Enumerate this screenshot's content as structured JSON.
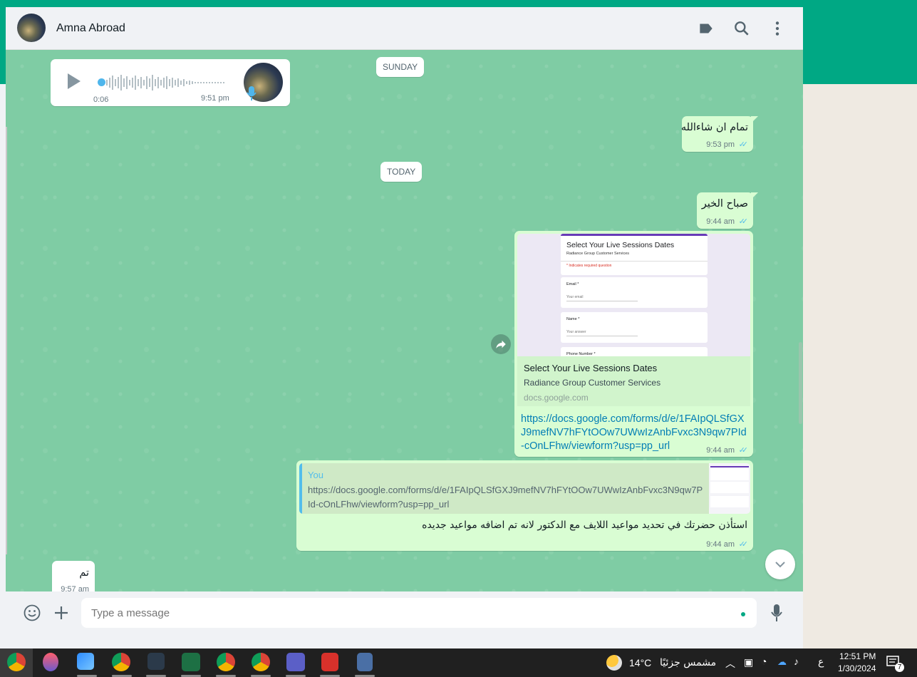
{
  "contact": {
    "name": "Amna Abroad"
  },
  "header_icons": [
    "label-icon",
    "search-icon",
    "menu-icon"
  ],
  "chat": {
    "voice_note": {
      "duration": "0:06",
      "time": "9:51 pm"
    },
    "dates": {
      "sunday": "SUNDAY",
      "today": "TODAY"
    },
    "messages": [
      {
        "text": "تمام ان شاءالله",
        "time": "9:53 pm"
      },
      {
        "text": "صباح الخير",
        "time": "9:44 am"
      },
      {
        "preview_image": {
          "form_title": "Select Your Live Sessions Dates",
          "form_subtitle": "Radiance Group Customer Services",
          "required_note": "* Indicates required question",
          "email_label": "Email *",
          "email_placeholder": "Your email",
          "name_label": "Name *",
          "name_placeholder": "Your answer",
          "phone_label": "Phone Number *"
        },
        "preview_title": "Select Your Live Sessions Dates",
        "preview_desc": "Radiance Group Customer Services",
        "preview_domain": "docs.google.com",
        "link": "https://docs.google.com/forms/d/e/1FAIpQLSfGXJ9mefNV7hFYtOOw7UWwIzAnbFvxc3N9qw7PId-cOnLFhw/viewform?usp=pp_url",
        "time": "9:44 am"
      },
      {
        "quote_author": "You",
        "quote_text": "https://docs.google.com/forms/d/e/1FAIpQLSfGXJ9mefNV7hFYtOOw7UWwIzAnbFvxc3N9qw7PId-cOnLFhw/viewform?usp=pp_url",
        "text": "استأذن حضرتك في تحديد مواعيد اللايف مع الدكتور لانه تم اضافه مواعيد جديده",
        "time": "9:44 am"
      },
      {
        "text": "تم",
        "time": "9:57 am"
      }
    ]
  },
  "composer": {
    "placeholder": "Type a message"
  },
  "taskbar": {
    "weather_temp": "14°C",
    "weather_text": "مشمس جزئيًا",
    "lang": "ع",
    "time": "12:51 PM",
    "date": "1/30/2024",
    "notifications": "7"
  },
  "colors": {
    "accent": "#00a884",
    "outgoing_bubble": "#d9fdd3",
    "chat_background": "#7fcca4",
    "link": "#027eb5",
    "read_ticks": "#53bdeb"
  }
}
